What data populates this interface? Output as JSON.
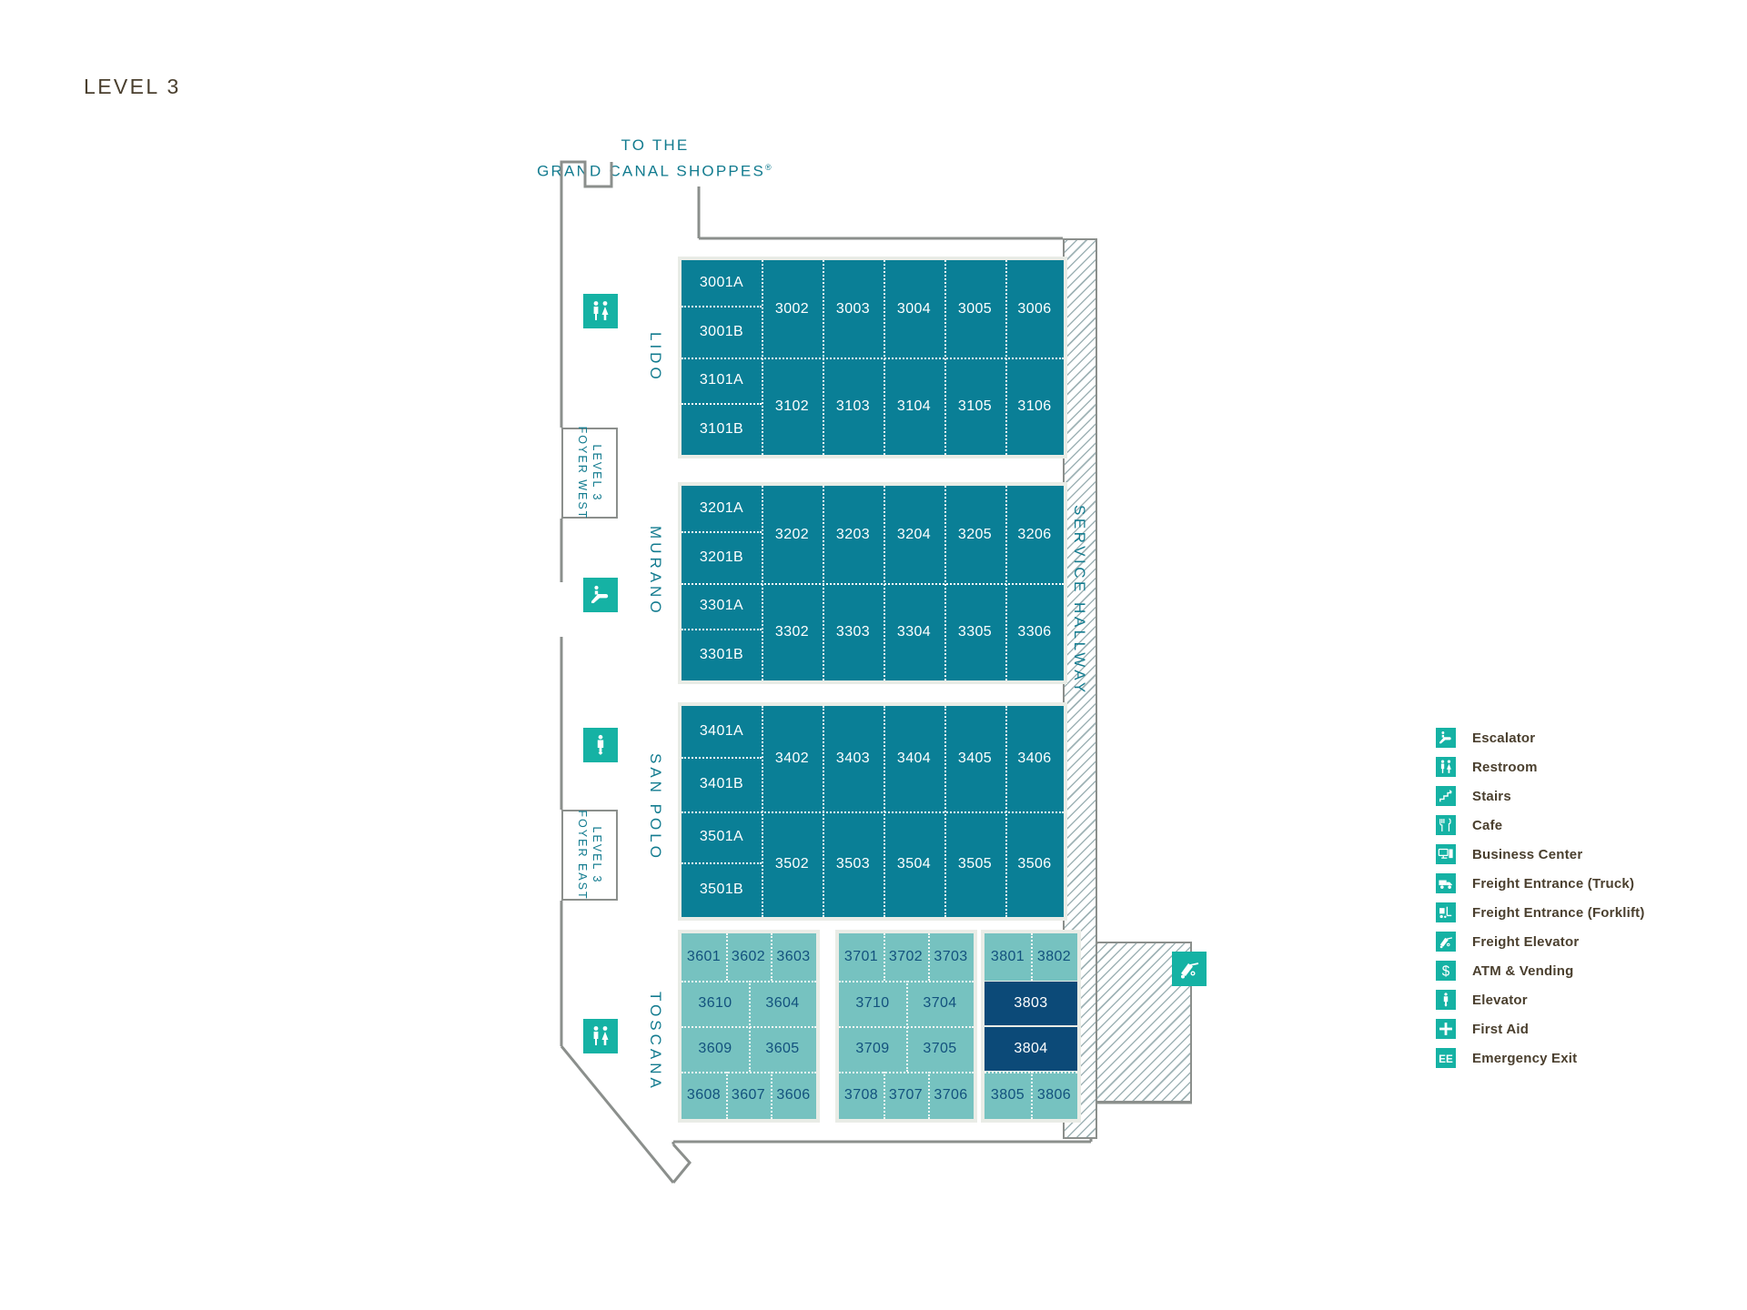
{
  "page": {
    "title": "LEVEL 3",
    "to_shoppes_line1": "TO THE",
    "to_shoppes_line2": "GRAND CANAL SHOPPES",
    "to_shoppes_mark": "®"
  },
  "colors": {
    "teal": "#0a7f96",
    "light_teal": "#76c2c0",
    "navy": "#0c4a78",
    "icon_green": "#15b2a4",
    "label_teal": "#127b8f",
    "text_brown": "#4a3f2e",
    "outline_gray": "#8b8f8c"
  },
  "service_hallway": {
    "label": "SERVICE HALLWAY"
  },
  "foyers": [
    {
      "id": "foyer-west",
      "line1": "LEVEL 3",
      "line2": "FOYER WEST"
    },
    {
      "id": "foyer-east",
      "line1": "LEVEL 3",
      "line2": "FOYER EAST"
    }
  ],
  "corridors": [
    {
      "id": "lido",
      "name": "LIDO"
    },
    {
      "id": "murano",
      "name": "MURANO"
    },
    {
      "id": "san-polo",
      "name": "SAN POLO"
    },
    {
      "id": "toscana",
      "name": "TOSCANA"
    }
  ],
  "blocks": [
    {
      "id": "lido",
      "rows": [
        {
          "split_left": [
            "3001A",
            "3001B"
          ],
          "cells": [
            "3002",
            "3003",
            "3004",
            "3005",
            "3006"
          ]
        },
        {
          "split_left": [
            "3101A",
            "3101B"
          ],
          "cells": [
            "3102",
            "3103",
            "3104",
            "3105",
            "3106"
          ]
        }
      ]
    },
    {
      "id": "murano",
      "rows": [
        {
          "split_left": [
            "3201A",
            "3201B"
          ],
          "cells": [
            "3202",
            "3203",
            "3204",
            "3205",
            "3206"
          ]
        },
        {
          "split_left": [
            "3301A",
            "3301B"
          ],
          "cells": [
            "3302",
            "3303",
            "3304",
            "3305",
            "3306"
          ]
        }
      ]
    },
    {
      "id": "san-polo",
      "rows": [
        {
          "split_left": [
            "3401A",
            "3401B"
          ],
          "cells": [
            "3402",
            "3403",
            "3404",
            "3405",
            "3406"
          ]
        },
        {
          "split_left": [
            "3501A",
            "3501B"
          ],
          "cells": [
            "3502",
            "3503",
            "3504",
            "3505",
            "3506"
          ]
        }
      ]
    }
  ],
  "toscana_blocks": [
    {
      "id": "toscana-36",
      "rows": [
        {
          "type": "three",
          "cells": [
            "3601",
            "3602",
            "3603"
          ]
        },
        {
          "type": "two",
          "cells": [
            "3610",
            "3604"
          ]
        },
        {
          "type": "two",
          "cells": [
            "3609",
            "3605"
          ]
        },
        {
          "type": "three",
          "cells": [
            "3608",
            "3607",
            "3606"
          ]
        }
      ]
    },
    {
      "id": "toscana-37",
      "rows": [
        {
          "type": "three",
          "cells": [
            "3701",
            "3702",
            "3703"
          ]
        },
        {
          "type": "two",
          "cells": [
            "3710",
            "3704"
          ]
        },
        {
          "type": "two",
          "cells": [
            "3709",
            "3705"
          ]
        },
        {
          "type": "three",
          "cells": [
            "3708",
            "3707",
            "3706"
          ]
        }
      ]
    },
    {
      "id": "toscana-38",
      "rows": [
        {
          "type": "two",
          "cells": [
            "3801",
            "3802"
          ],
          "style": "light"
        },
        {
          "type": "one",
          "cells": [
            "3803"
          ],
          "style": "navy"
        },
        {
          "type": "one",
          "cells": [
            "3804"
          ],
          "style": "navy"
        },
        {
          "type": "two",
          "cells": [
            "3805",
            "3806"
          ],
          "style": "light"
        }
      ]
    }
  ],
  "map_icons": [
    {
      "id": "restroom-north",
      "icon": "restroom-icon"
    },
    {
      "id": "escalator-mid",
      "icon": "escalator-icon"
    },
    {
      "id": "elevator-mid",
      "icon": "elevator-icon"
    },
    {
      "id": "restroom-south",
      "icon": "restroom-icon"
    },
    {
      "id": "freight-elevator-dock",
      "icon": "freight-elevator-icon"
    }
  ],
  "legend": {
    "items": [
      {
        "icon": "escalator-icon",
        "label": "Escalator"
      },
      {
        "icon": "restroom-icon",
        "label": "Restroom"
      },
      {
        "icon": "stairs-icon",
        "label": "Stairs"
      },
      {
        "icon": "cafe-icon",
        "label": "Cafe"
      },
      {
        "icon": "business-center-icon",
        "label": "Business Center"
      },
      {
        "icon": "freight-truck-icon",
        "label": "Freight Entrance (Truck)"
      },
      {
        "icon": "freight-forklift-icon",
        "label": "Freight Entrance (Forklift)"
      },
      {
        "icon": "freight-elevator-icon",
        "label": "Freight Elevator"
      },
      {
        "icon": "atm-vending-icon",
        "label": "ATM & Vending"
      },
      {
        "icon": "elevator-icon",
        "label": "Elevator"
      },
      {
        "icon": "first-aid-icon",
        "label": "First Aid"
      },
      {
        "icon": "emergency-exit-icon",
        "label": "Emergency Exit"
      }
    ]
  }
}
